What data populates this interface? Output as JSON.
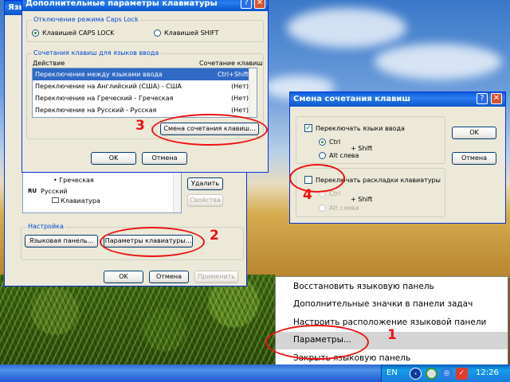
{
  "dialog_main": {
    "title": "Дополнительные параметры клавиатуры",
    "caps_group": "Отключение режима Caps Lock",
    "caps_option1": "Клавишей CAPS LOCK",
    "caps_option2": "Клавишей SHIFT",
    "hotkey_group": "Сочетания клавиш для языков ввода",
    "col_action": "Действие",
    "col_combo": "Сочетание клавиш",
    "rows": [
      {
        "action": "Переключение между языками ввода",
        "combo": "Ctrl+Shift"
      },
      {
        "action": "Переключение на Английский (США) - США",
        "combo": "(Нет)"
      },
      {
        "action": "Переключение на Греческий - Греческая",
        "combo": "(Нет)"
      },
      {
        "action": "Переключение на Русский - Русская",
        "combo": "(Нет)"
      }
    ],
    "change_btn": "Смена сочетания клавиш...",
    "ok_btn": "OK",
    "cancel_btn": "Отмена"
  },
  "dialog_lang": {
    "partial_title": "Язы",
    "tree_item_greek": "Греческая",
    "tree_lang_ru_code": "RU",
    "tree_lang_ru": "Русский",
    "tree_keyboard": "Клавиатура",
    "delete_btn": "Удалить",
    "props_btn": "Свойства",
    "settings_group": "Настройка",
    "langbar_btn": "Языковая панель...",
    "kbd_params_btn": "Параметры клавиатуры...",
    "ok_btn": "OK",
    "cancel_btn": "Отмена",
    "apply_btn": "Применить"
  },
  "dialog_change": {
    "title": "Смена сочетания клавиш",
    "help": "?",
    "switch_langs": "Переключать языки ввода",
    "ctrl": "Ctrl",
    "alt_left": "Alt слева",
    "shift": "+ Shift",
    "switch_layouts": "Переключать раскладки клавиатуры",
    "ctrl2": "Ctrl",
    "alt_left2": "Alt слева",
    "shift2": "+ Shift",
    "ok_btn": "OK",
    "cancel_btn": "Отмена"
  },
  "context_menu": {
    "items": [
      "Восстановить языковую панель",
      "Дополнительные значки в панели задач",
      "Настроить расположение языковой панели",
      "Параметры...",
      "Закрыть языковую панель"
    ]
  },
  "taskbar": {
    "lang": "EN",
    "clock": "12:26"
  },
  "annotations": {
    "n1": "1",
    "n2": "2",
    "n3": "3",
    "n4": "4"
  },
  "colors": {
    "annotation": "#ee1111",
    "xp_title": "#0a5fd8",
    "selection": "#316ac5"
  }
}
